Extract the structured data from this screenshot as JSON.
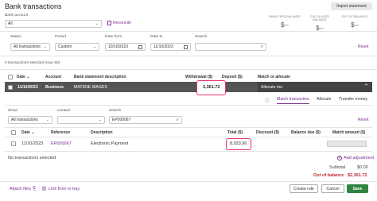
{
  "header": {
    "title": "Bank transactions",
    "import_label": "Import statement",
    "bank_account_label": "Bank account",
    "bank_account_value": "All",
    "reconcile_label": "Reconcile",
    "balances": [
      {
        "title": "BANK FEED BALANCE",
        "value": "$--"
      },
      {
        "title": "CALCULATED BALANCE",
        "value": "$--"
      },
      {
        "title": "OUT OF BALANCE",
        "value": "$--"
      }
    ]
  },
  "filters": {
    "status_label": "Status",
    "status_value": "All transactions",
    "period_label": "Period",
    "period_value": "Custom",
    "date_from_label": "Date from",
    "date_from_value": "10/10/2023",
    "date_to_label": "Date to",
    "date_to_value": "11/10/2023",
    "search_label": "Search",
    "search_value": "",
    "reset_label": "Reset"
  },
  "selection_text": "0 transactions selected (max 50)",
  "table": {
    "columns": [
      "Date",
      "Account",
      "Bank statement description",
      "Withdrawal ($)",
      "Deposit ($)",
      "Match or allocate"
    ],
    "row": {
      "date": "11/10/2023",
      "account": "Business",
      "description": "MATENE WAGES",
      "withdrawal": "2,361.72",
      "deposit": "",
      "match": "Allocate me"
    }
  },
  "detail": {
    "tabs": [
      "Match transaction",
      "Allocate",
      "Transfer money"
    ],
    "show_label": "Show",
    "show_value": "All transactions",
    "contact_label": "Contact",
    "contact_value": "",
    "search_label": "Search",
    "search_value": "EP000067",
    "reset_label": "Reset",
    "columns": [
      "Date",
      "Reference",
      "Description",
      "Total ($)",
      "Discount ($)",
      "Balance due ($)",
      "Match amount ($)"
    ],
    "row": {
      "date": "11/10/2023",
      "reference": "EP000067",
      "description": "Electronic Payment",
      "total": "8,933.96",
      "discount": "",
      "balance_due": "",
      "match_amount": ""
    },
    "no_selected": "No transactions selected",
    "add_adjustment": "Add adjustment",
    "subtotal_label": "Subtotal",
    "subtotal_value": "$0.00",
    "out_of_balance_label": "Out of balance",
    "out_of_balance_value": "$2,361.72"
  },
  "footer": {
    "attach_files": "Attach files",
    "link_from_tray": "Link from in tray",
    "create_rule": "Create rule",
    "cancel": "Cancel",
    "save": "Save"
  },
  "colors": {
    "accent": "#7b2d8e",
    "highlight": "#e8307a",
    "save": "#2e8540",
    "error": "#c0282e"
  }
}
